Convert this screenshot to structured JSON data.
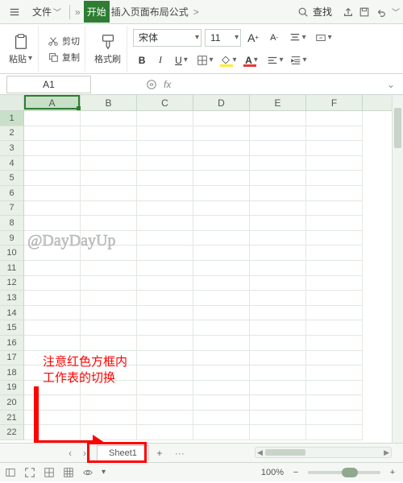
{
  "menubar": {
    "menu_icon": "hamburger-icon",
    "file_label": "文件",
    "tabs": [
      "开始",
      "插入",
      "页面布局",
      "公式"
    ],
    "active_tab_index": 0,
    "search_label": "查找"
  },
  "ribbon": {
    "paste_label": "粘贴",
    "cut_label": "剪切",
    "copy_label": "复制",
    "format_painter_label": "格式刷",
    "font_name": "宋体",
    "font_size": "11"
  },
  "formula_bar": {
    "name_box": "A1",
    "fx_label": "fx",
    "formula_value": ""
  },
  "grid": {
    "columns": [
      "A",
      "B",
      "C",
      "D",
      "E",
      "F"
    ],
    "row_count": 22,
    "active_cell": "A1",
    "selected_col": "A",
    "selected_row": 1
  },
  "watermark": "@DayDayUp",
  "annotation": {
    "line1": "注意红色方框内",
    "line2": "工作表的切换"
  },
  "sheetbar": {
    "active_sheet": "Sheet1",
    "add_label": "+",
    "more": "···"
  },
  "statusbar": {
    "zoom_label": "100%"
  }
}
